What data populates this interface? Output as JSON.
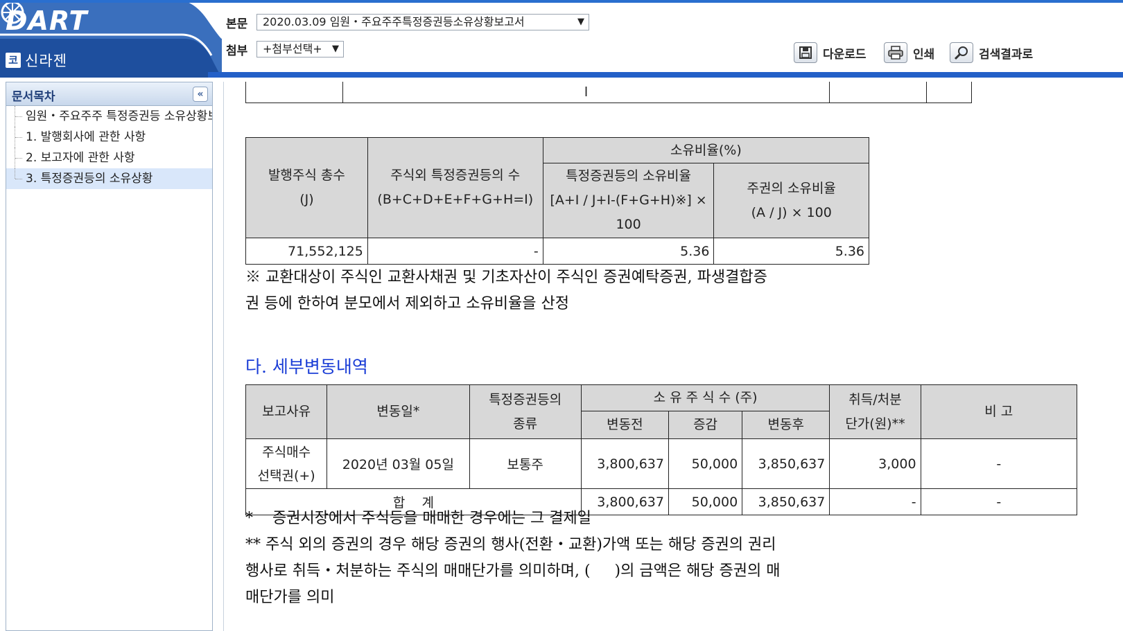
{
  "header": {
    "logo": "DART",
    "company_badge": "코",
    "company_name": "신라젠",
    "body_label": "본문",
    "body_select": "2020.03.09   임원・주요주주특정증권등소유상황보고서",
    "attach_label": "첨부",
    "attach_select": "+첨부선택+",
    "buttons": {
      "download": "다운로드",
      "print": "인쇄",
      "search": "검색결과로"
    }
  },
  "sidebar": {
    "title": "문서목차",
    "collapse": "«",
    "items": [
      {
        "label": "임원・주요주주 특정증권등 소유상황보고서"
      },
      {
        "label": "1. 발행회사에 관한 사항"
      },
      {
        "label": "2. 보고자에 관한 사항"
      },
      {
        "label": "3. 특정증권등의 소유상황"
      }
    ]
  },
  "doc": {
    "top_fragment": "l",
    "ratio_table": {
      "h_total": "발행주식 총수",
      "h_total_sub": "(J)",
      "h_other": "주식외 특정증권등의 수",
      "h_other_sub": "(B+C+D+E+F+G+H=I)",
      "h_ratio": "소유비율(%)",
      "h_specific": "특정증권등의 소유비율",
      "h_specific_sub1": "[A+I / J+I-(F+G+H)※] ×",
      "h_specific_sub2": "100",
      "h_stock": "주권의 소유비율",
      "h_stock_sub": "(A / J) × 100",
      "v_total": "71,552,125",
      "v_other": "-",
      "v_specific": "5.36",
      "v_stock": "5.36"
    },
    "ratio_note_1": "※ 교환대상이 주식인 교환사채권 및 기초자산이 주식인 증권예탁증권, 파생결합증",
    "ratio_note_2": "권 등에 한하여 분모에서 제외하고 소유비율을 산정",
    "section_title": "다. 세부변동내역",
    "change_table": {
      "h_reason": "보고사유",
      "h_date": "변동일*",
      "h_kind_1": "특정증권등의",
      "h_kind_2": "종류",
      "h_shares": "소 유 주 식 수 (주)",
      "h_before": "변동전",
      "h_delta": "증감",
      "h_after": "변동후",
      "h_price_1": "취득/처분",
      "h_price_2": "단가(원)**",
      "h_remark": "비 고",
      "row_reason_1": "주식매수",
      "row_reason_2": "선택권(+)",
      "row_date": "2020년 03월 05일",
      "row_kind": "보통주",
      "row_before": "3,800,637",
      "row_delta": "50,000",
      "row_after": "3,850,637",
      "row_price": "3,000",
      "row_remark": "-",
      "sum_label": "합    계",
      "sum_before": "3,800,637",
      "sum_delta": "50,000",
      "sum_after": "3,850,637",
      "sum_price": "-",
      "sum_remark": "-"
    },
    "footnote_1": "*    증권시장에서 주식등을 매매한 경우에는 그 결제일",
    "footnote_2": "** 주식 외의 증권의 경우 해당 증권의 행사(전환・교환)가액 또는 해당 증권의 권리",
    "footnote_3": "행사로 취득・처분하는 주식의 매매단가를 의미하며, (     )의 금액은 해당 증권의 매",
    "footnote_4": "매단가를 의미"
  },
  "colors": {
    "header_blue": "#1e4f9e",
    "accent_line": "#2360c8",
    "section_title": "#1a3dd6",
    "th_bg": "#d8d8d8"
  }
}
